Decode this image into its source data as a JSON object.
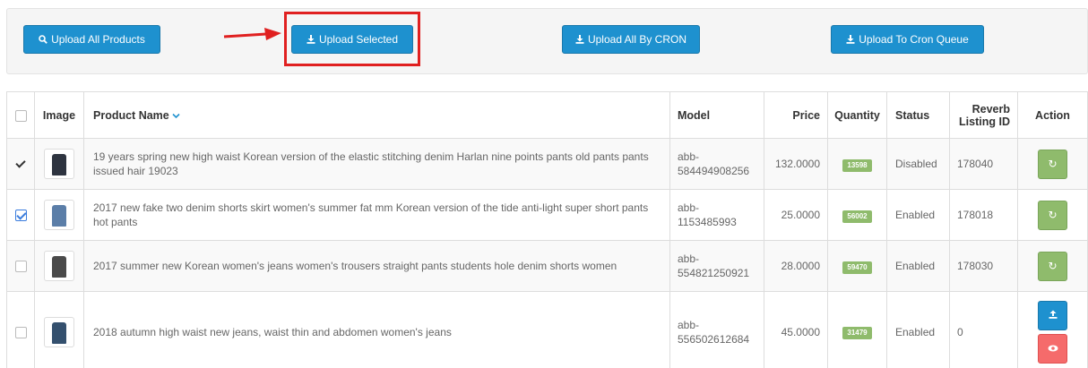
{
  "toolbar": {
    "upload_all_products": "Upload All Products",
    "upload_selected": "Upload Selected",
    "upload_all_by_cron": "Upload All By CRON",
    "upload_to_cron_queue": "Upload To Cron Queue"
  },
  "table": {
    "headers": {
      "image": "Image",
      "product_name": "Product Name",
      "model": "Model",
      "price": "Price",
      "quantity": "Quantity",
      "status": "Status",
      "reverb_listing_id": "Reverb Listing ID",
      "action": "Action"
    },
    "sort_indicator": "chevron-down-icon",
    "rows": [
      {
        "checked": true,
        "name": "19 years spring new high waist Korean version of the elastic stitching denim Harlan nine points pants old pants pants issued hair 19023",
        "model": "abb-584494908256",
        "price": "132.0000",
        "quantity": "13598",
        "status": "Disabled",
        "reverb_id": "178040",
        "actions": [
          "sync"
        ]
      },
      {
        "checked": true,
        "name": "2017 new fake two denim shorts skirt women's summer fat mm Korean version of the tide anti-light super short pants hot pants",
        "model": "abb-1153485993",
        "price": "25.0000",
        "quantity": "56002",
        "status": "Enabled",
        "reverb_id": "178018",
        "actions": [
          "sync"
        ]
      },
      {
        "checked": false,
        "name": "2017 summer new Korean women's jeans women's trousers straight pants students hole denim shorts women",
        "model": "abb-554821250921",
        "price": "28.0000",
        "quantity": "59470",
        "status": "Enabled",
        "reverb_id": "178030",
        "actions": [
          "sync"
        ]
      },
      {
        "checked": false,
        "name": "2018 autumn high waist new jeans, waist thin and abdomen women's jeans",
        "model": "abb-556502612684",
        "price": "45.0000",
        "quantity": "31479",
        "status": "Enabled",
        "reverb_id": "0",
        "actions": [
          "upload",
          "view"
        ]
      }
    ]
  },
  "colors": {
    "primary": "#1e91cf",
    "success": "#8fbb6c",
    "danger": "#f56b6b",
    "highlight": "#e02020"
  }
}
